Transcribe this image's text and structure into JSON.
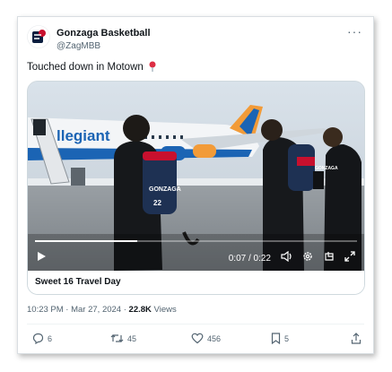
{
  "post": {
    "display_name": "Gonzaga Basketball",
    "handle": "@ZagMBB",
    "more_label": "···",
    "text": "Touched down in Motown",
    "text_emoji_icon": "round-pushpin-icon"
  },
  "media": {
    "type": "video",
    "time_display": "0:07 / 0:22",
    "caption": "Sweet 16 Travel Day",
    "scene_text": {
      "plane_livery": "llegiant",
      "jersey_1": "GONZAGA",
      "jersey_number": "22",
      "jersey_2": "GONZAGA"
    },
    "controls": {
      "play_icon": "play-icon",
      "volume_icon": "speaker-icon",
      "settings_icon": "gear-icon",
      "pip_icon": "picture-in-picture-icon",
      "fullscreen_icon": "expand-icon"
    }
  },
  "meta": {
    "timestamp": "10:23 PM · Mar 27, 2024",
    "separator": " · ",
    "views_count": "22.8K",
    "views_label": " Views"
  },
  "actions": {
    "replies": "6",
    "reposts": "45",
    "likes": "456",
    "bookmarks": "5"
  },
  "colors": {
    "text": "#0f1419",
    "muted": "#536471",
    "border": "#cfd9de"
  }
}
